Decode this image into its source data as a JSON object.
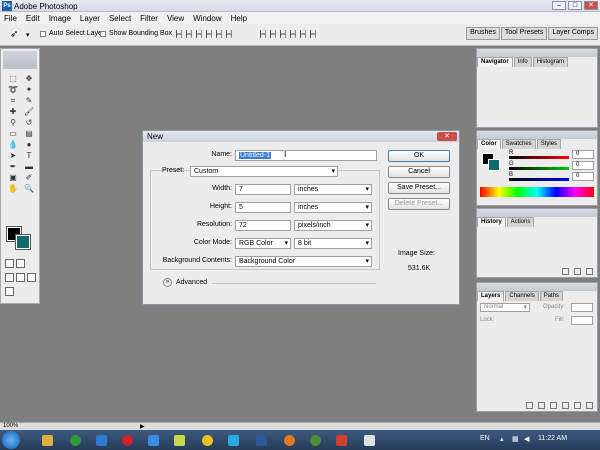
{
  "window": {
    "title": "Adobe Photoshop",
    "logo_text": "Ps"
  },
  "menubar": [
    "File",
    "Edit",
    "Image",
    "Layer",
    "Select",
    "Filter",
    "View",
    "Window",
    "Help"
  ],
  "options_bar": {
    "auto_select_layer": "Auto Select Layer",
    "show_bounding_box": "Show Bounding Box"
  },
  "palette_well": [
    "Brushes",
    "Tool Presets",
    "Layer Comps"
  ],
  "dialog": {
    "title": "New",
    "name_label": "Name:",
    "name_value": "Untitled-1",
    "preset_label": "Preset:",
    "preset_value": "Custom",
    "width_label": "Width:",
    "width_value": "7",
    "width_unit": "inches",
    "height_label": "Height:",
    "height_value": "5",
    "height_unit": "inches",
    "resolution_label": "Resolution:",
    "resolution_value": "72",
    "resolution_unit": "pixels/inch",
    "color_mode_label": "Color Mode:",
    "color_mode_value": "RGB Color",
    "bit_depth_value": "8 bit",
    "background_label": "Background Contents:",
    "background_value": "Background Color",
    "advanced_label": "Advanced",
    "ok_label": "OK",
    "cancel_label": "Cancel",
    "save_preset_label": "Save Preset...",
    "delete_preset_label": "Delete Preset...",
    "image_size_label": "Image Size:",
    "image_size_value": "531.6K"
  },
  "panels": {
    "navigator": {
      "tabs": [
        "Navigator",
        "Info",
        "Histogram"
      ]
    },
    "color": {
      "tabs": [
        "Color",
        "Swatches",
        "Styles"
      ],
      "r_value": "0",
      "g_value": "0",
      "b_value": "0",
      "r_label": "R",
      "g_label": "G",
      "b_label": "B"
    },
    "history": {
      "tabs": [
        "History",
        "Actions"
      ]
    },
    "layers": {
      "tabs": [
        "Layers",
        "Channels",
        "Paths"
      ],
      "blend_mode": "Normal",
      "opacity_label": "Opacity:",
      "lock_label": "Lock:",
      "fill_label": "Fill:"
    }
  },
  "status": {
    "zoom": "100%"
  },
  "taskbar": {
    "lang": "EN",
    "time": "11:22 AM"
  },
  "colors": {
    "foreground": "#000000",
    "background": "#0f6a6a",
    "accent": "#3c7fb1"
  }
}
